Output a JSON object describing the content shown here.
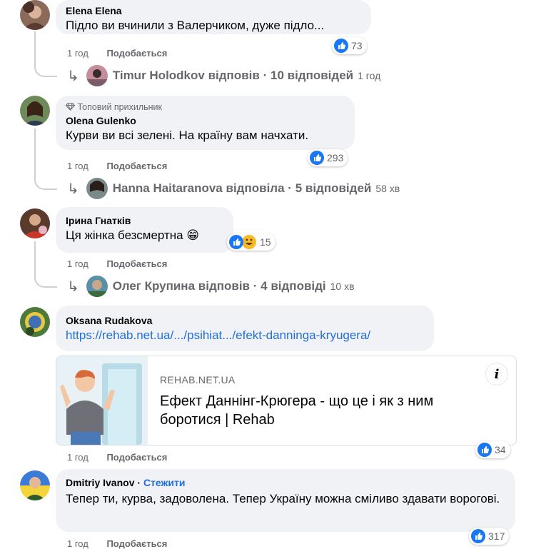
{
  "comments": [
    {
      "author": "Elena Elena",
      "text": "Підло ви вчинили з Валерчиком, дуже підло...",
      "time": "1 год",
      "like_action": "Подобається",
      "reaction_count": "73",
      "replies": {
        "author": "Timur Holodkov",
        "verb": "відповів",
        "count": "10 відповідей",
        "time": "1 год"
      }
    },
    {
      "badge": "Топовий прихильник",
      "author": "Olena Gulenko",
      "text": "Курви ви всі зелені. На країну вам начхати.",
      "time": "1 год",
      "like_action": "Подобається",
      "reaction_count": "293",
      "replies": {
        "author": "Hanna Haitaranova",
        "verb": "відповіла",
        "count": "5 відповідей",
        "time": "58 хв"
      }
    },
    {
      "author": "Ірина Гнатків",
      "text": "Ця жінка безсмертна 😁",
      "time": "1 год",
      "like_action": "Подобається",
      "reaction_count": "15",
      "replies": {
        "author": "Олег Крупина",
        "verb": "відповів",
        "count": "4 відповіді",
        "time": "10 хв"
      }
    },
    {
      "author": "Oksana Rudakova",
      "link_text": "https://rehab.net.ua/.../psihiat.../efekt-danninga-kryugera/",
      "card": {
        "domain": "REHAB.NET.UA",
        "title": "Ефект Даннінг-Крюгера - що це і як з ним боротися | Rehab",
        "info": "i"
      },
      "time": "1 год",
      "like_action": "Подобається",
      "reaction_count": "34"
    },
    {
      "author": "Dmitriy Ivanov",
      "follow": "Стежити",
      "text": "Тепер ти, курва, задоволена. Тепер Україну можна сміливо здавати ворогові.",
      "time": "1 год",
      "like_action": "Подобається",
      "reaction_count": "317"
    }
  ],
  "separator": "·",
  "icons": {
    "like": "like-icon",
    "haha": "haha-icon",
    "reply_arrow": "reply-arrow-icon",
    "diamond": "diamond-icon"
  },
  "colors": {
    "link": "#216fdb",
    "like_blue": "#1877f2",
    "bubble": "#f0f2f5",
    "meta": "#65676b"
  }
}
